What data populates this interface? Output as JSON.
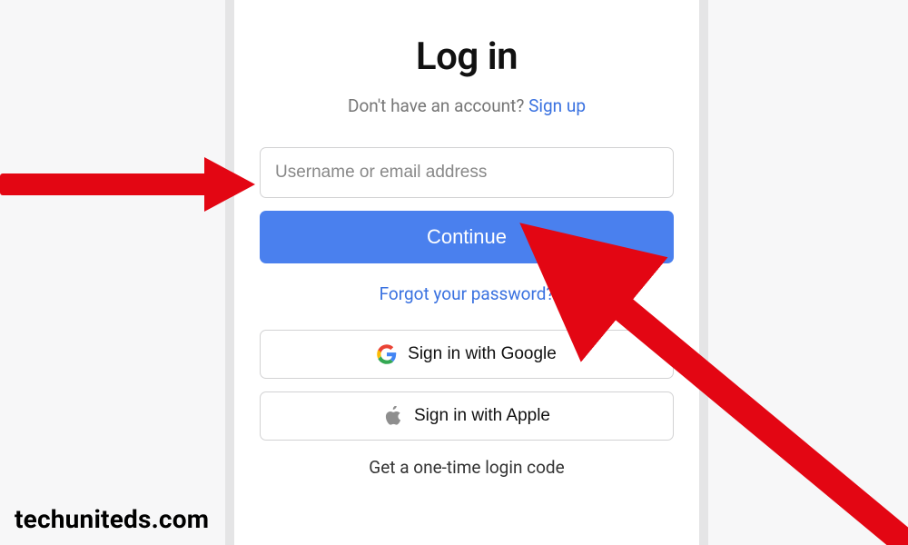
{
  "title": "Log in",
  "prompt": {
    "text": "Don't have an account? ",
    "link": "Sign up"
  },
  "input": {
    "placeholder": "Username or email address",
    "value": ""
  },
  "continue_label": "Continue",
  "forgot_label": "Forgot your password?",
  "oauth": {
    "google": "Sign in with Google",
    "apple": "Sign in with Apple"
  },
  "onetime_label": "Get a one-time login code",
  "watermark": "techuniteds.com",
  "colors": {
    "primary": "#4a80ee",
    "link": "#3971e0",
    "annotation": "#e30613"
  }
}
